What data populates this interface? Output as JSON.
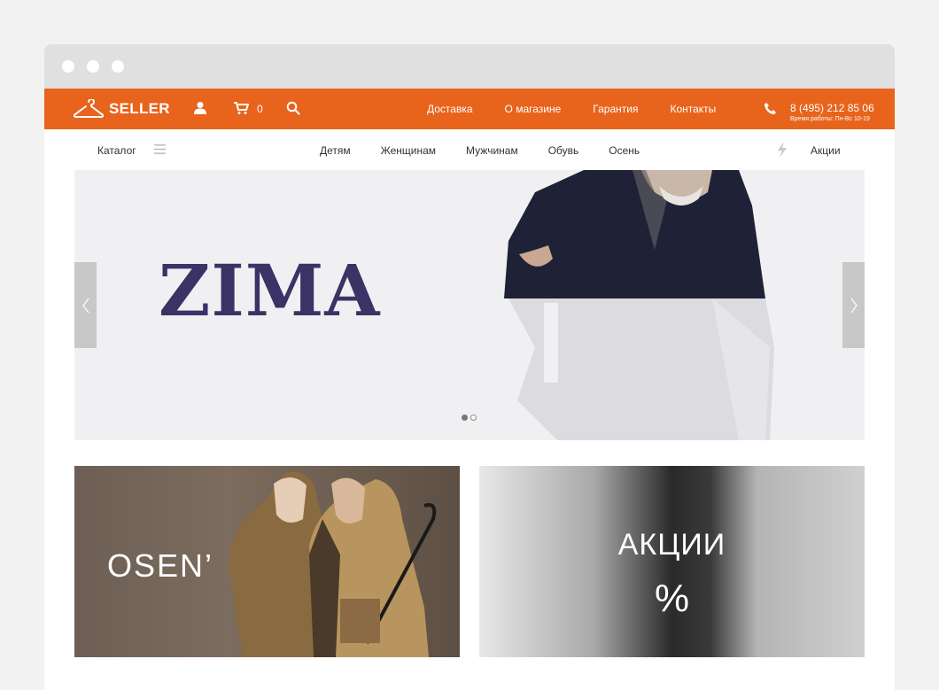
{
  "header": {
    "logo_text": "SELLER",
    "cart_count": "0",
    "nav": [
      "Доставка",
      "О магазине",
      "Гарантия",
      "Контакты"
    ],
    "phone": "8 (495) 212 85 06",
    "hours": "Время работы: Пн-Вс 10-19"
  },
  "catbar": {
    "catalog_label": "Каталог",
    "categories": [
      "Детям",
      "Женщинам",
      "Мужчинам",
      "Обувь",
      "Осень"
    ],
    "promo_label": "Акции"
  },
  "hero": {
    "title": "ZIMA",
    "slide_count": 2,
    "active_slide": 1
  },
  "banners": {
    "osen_text": "OSEN’",
    "sale_text": "АКЦИИ",
    "sale_sub": "%"
  },
  "colors": {
    "accent": "#e8631c",
    "hero_title": "#3b3266",
    "background": "#f2f2f2"
  }
}
